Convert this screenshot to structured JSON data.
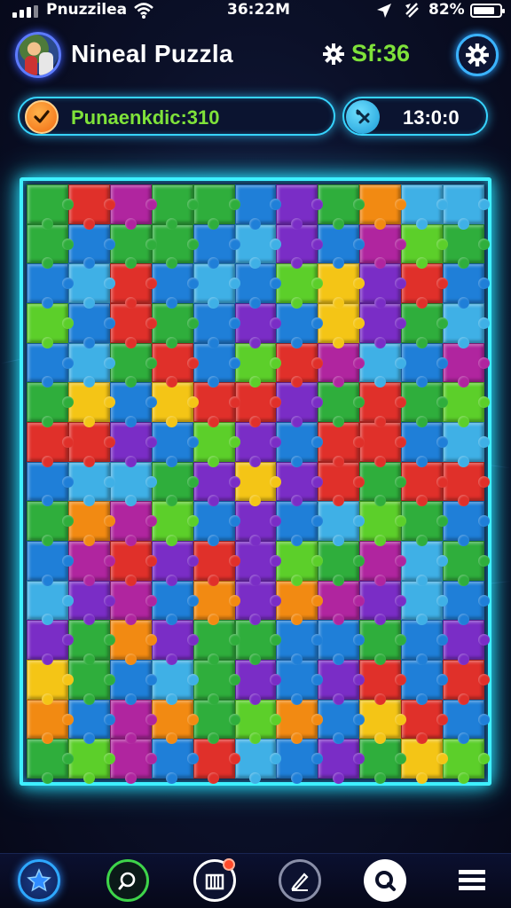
{
  "status_bar": {
    "carrier": "Pnuzzilea",
    "time": "36:22M",
    "battery_pct": "82%",
    "battery_level": 0.82,
    "icons": [
      "signal-bars-icon",
      "wifi-icon",
      "location-arrow-icon",
      "alarm-icon",
      "battery-icon"
    ]
  },
  "header": {
    "title": "Nineal Puzzla",
    "score_icon": "gear-icon",
    "score": "Sf:36",
    "settings_icon": "gear-icon"
  },
  "progress_pill": {
    "icon": "checkmark-icon",
    "label": "Punaenkdic:310"
  },
  "timer_pill": {
    "icon": "timer-icon",
    "value": "13:0:0"
  },
  "board": {
    "columns": 11,
    "rows": 15,
    "palette": {
      "G": "#2fae3c",
      "L": "#5ccf2a",
      "B": "#1f7fd8",
      "C": "#3fb0e6",
      "P": "#7a2dc6",
      "M": "#b0259f",
      "R": "#e0302a",
      "O": "#f28a12",
      "Y": "#f4c516"
    },
    "rows_colors": [
      "GRMGGBPGOCC",
      "GBGGBCPBMLG",
      "BCRBCBLYPRB",
      "LBRGBPBYPGC",
      "BCGRBLRMCBM",
      "GYBYRRPGRGL",
      "RRPBLPBRRBC",
      "BCCGPYPRGRR",
      "GOMLBPBCLGB",
      "BMRPRPLGMCG",
      "CPMBOPOMPCB",
      "PGOPGGBBGBP",
      "YGBCGPBPRBR",
      "OBMOGLOBYRB",
      "GLMBRCBPGYL"
    ]
  },
  "nav": {
    "items": [
      {
        "icon": "star-icon",
        "active": true
      },
      {
        "icon": "search-icon"
      },
      {
        "icon": "puzzle-box-icon",
        "badge": true
      },
      {
        "icon": "edit-pencil-icon"
      },
      {
        "icon": "chat-search-icon"
      },
      {
        "icon": "menu-list-icon"
      }
    ]
  }
}
